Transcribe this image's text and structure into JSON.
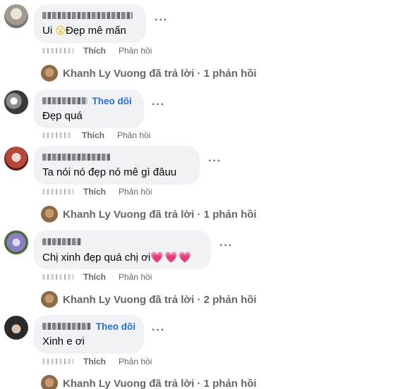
{
  "comments": [
    {
      "follow": "",
      "text": "Ui ",
      "text_after": "Đẹp mê mấn",
      "emoji": "😮",
      "like": "Thích",
      "reply": "Phản hồi",
      "more": "···",
      "replies": {
        "author": "Khanh Ly Vuong",
        "summary": "đã trả lời · 1 phản hồi"
      }
    },
    {
      "follow": "Theo dõi",
      "text": "Đẹp quá",
      "like": "Thích",
      "reply": "Phản hồi",
      "more": "···"
    },
    {
      "follow": "",
      "text": "Ta nói nó đẹp nó mê gì đâuu",
      "like": "Thích",
      "reply": "Phản hồi",
      "more": "···",
      "replies": {
        "author": "Khanh Ly Vuong",
        "summary": "đã trả lời · 1 phản hồi"
      }
    },
    {
      "follow": "",
      "text": "Chị xinh đẹp quá chị ơi",
      "emoji": "💗💗💗",
      "like": "Thích",
      "reply": "Phản hồi",
      "more": "···",
      "replies": {
        "author": "Khanh Ly Vuong",
        "summary": "đã trả lời · 2 phản hồi"
      }
    },
    {
      "follow": "Theo dõi",
      "text": "Xinh e ơi",
      "like": "Thích",
      "reply": "Phản hồi",
      "more": "···",
      "replies": {
        "author": "Khanh Ly Vuong",
        "summary": "đã trả lời · 1 phản hồi"
      }
    }
  ],
  "colors": {
    "follow": "#216fdb",
    "bubble": "#f0f2f5",
    "muted": "#65676b"
  }
}
